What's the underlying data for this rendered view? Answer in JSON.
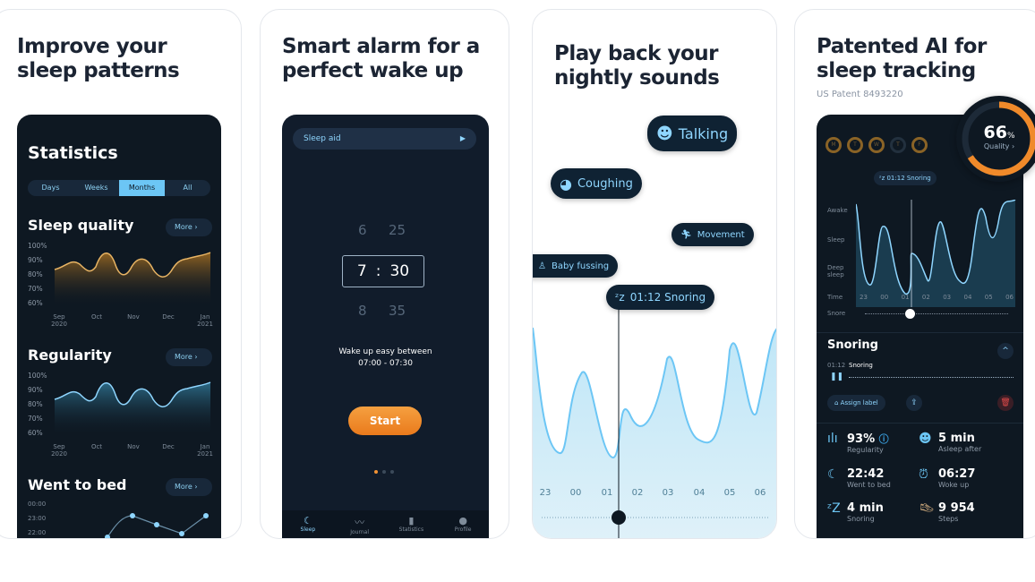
{
  "panels": [
    {
      "headline": [
        "Improve your",
        "sleep patterns"
      ],
      "statistics": {
        "title": "Statistics",
        "tabs": [
          "Days",
          "Weeks",
          "Months",
          "All"
        ],
        "active_tab": "Months",
        "more": "More",
        "sleep_quality": {
          "title": "Sleep quality",
          "y_ticks": [
            "100%",
            "90%",
            "80%",
            "70%",
            "60%"
          ],
          "x_ticks": [
            [
              "Sep",
              "2020"
            ],
            [
              "Oct",
              ""
            ],
            [
              "Nov",
              ""
            ],
            [
              "Dec",
              ""
            ],
            [
              "Jan",
              "2021"
            ]
          ],
          "color": "#e0a54a"
        },
        "regularity": {
          "title": "Regularity",
          "y_ticks": [
            "100%",
            "90%",
            "80%",
            "70%",
            "60%"
          ],
          "x_ticks": [
            [
              "Sep",
              "2020"
            ],
            [
              "Oct",
              ""
            ],
            [
              "Nov",
              ""
            ],
            [
              "Dec",
              ""
            ],
            [
              "Jan",
              "2021"
            ]
          ],
          "color": "#6cc6f5"
        },
        "went_to_bed": {
          "title": "Went to bed",
          "y_ticks": [
            "00:00",
            "23:00",
            "22:00"
          ]
        }
      }
    },
    {
      "headline": [
        "Smart alarm for a",
        "perfect wake up"
      ],
      "alarm": {
        "sleep_aid": "Sleep aid",
        "hours": [
          "6",
          "7",
          "8"
        ],
        "minutes": [
          "25",
          "30",
          "35"
        ],
        "separator": ":",
        "wake_text": "Wake up easy between",
        "window": "07:00 - 07:30",
        "start": "Start",
        "nav": [
          "Sleep",
          "Journal",
          "Statistics",
          "Profile"
        ]
      }
    },
    {
      "headline": [
        "Play back your",
        "nightly sounds"
      ],
      "sounds": {
        "labels": [
          "Talking",
          "Coughing",
          "Movement",
          "Baby fussing"
        ],
        "marker": "01:12 Snoring",
        "times": [
          "23",
          "00",
          "01",
          "02",
          "03",
          "04",
          "05",
          "06"
        ]
      }
    },
    {
      "headline": [
        "Patented AI for",
        "sleep tracking"
      ],
      "subtitle": "US Patent 8493220",
      "tracker": {
        "days": [
          "M",
          "T",
          "W",
          "T",
          "F"
        ],
        "quality_value": "66",
        "quality_unit": "%",
        "quality_label": "Quality",
        "quality_fraction": 0.66,
        "marker": "01:12 Snoring",
        "stages": [
          "Awake",
          "Sleep",
          "Deep sleep"
        ],
        "time_label": "Time",
        "snore_label": "Snore",
        "times": [
          "23",
          "00",
          "01",
          "02",
          "03",
          "04",
          "05",
          "06"
        ],
        "snoring": {
          "title": "Snoring",
          "time": "01:12",
          "label": "Snoring",
          "assign": "Assign label"
        },
        "stats": [
          {
            "value": "93%",
            "label": "Regularity"
          },
          {
            "value": "5 min",
            "label": "Asleep after"
          },
          {
            "value": "22:42",
            "label": "Went to bed"
          },
          {
            "value": "06:27",
            "label": "Woke up"
          },
          {
            "value": "4 min",
            "label": "Snoring"
          },
          {
            "value": "9 954",
            "label": "Steps"
          }
        ]
      }
    }
  ]
}
